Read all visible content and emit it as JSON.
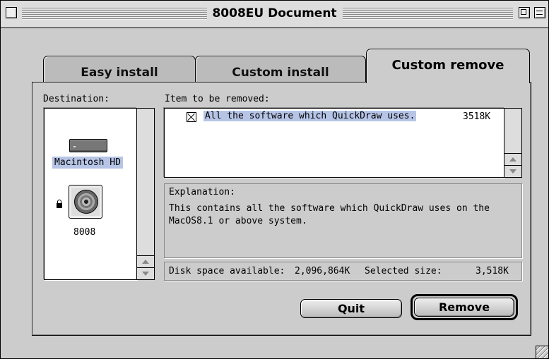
{
  "window": {
    "title": "8008EU Document"
  },
  "tabs": [
    {
      "label": "Easy install",
      "active": false
    },
    {
      "label": "Custom install",
      "active": false
    },
    {
      "label": "Custom remove",
      "active": true
    }
  ],
  "destination": {
    "label": "Destination:",
    "volumes": [
      {
        "name": "Macintosh HD",
        "icon": "hard-disk-icon",
        "selected": true
      },
      {
        "name": "8008",
        "icon": "cd-rom-icon",
        "locked": true
      }
    ]
  },
  "items": {
    "label": "Item to be removed:",
    "list": [
      {
        "name": "All the software which QuickDraw uses.",
        "size": "3518K",
        "checked": true
      }
    ]
  },
  "explanation": {
    "label": "Explanation:",
    "text": "This contains all the software which QuickDraw uses on the MacOS8.1 or above system."
  },
  "disk": {
    "available_label": "Disk space available:",
    "available_value": "2,096,864K",
    "selected_label": "Selected size:",
    "selected_value": "3,518K"
  },
  "buttons": {
    "quit": "Quit",
    "remove": "Remove"
  },
  "colors": {
    "selection": "#b6c4e6",
    "window_bg": "#cccccc"
  }
}
